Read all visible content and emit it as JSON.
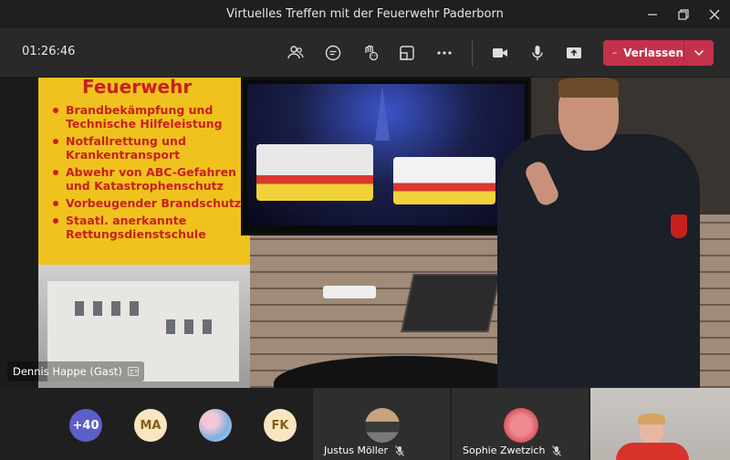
{
  "window": {
    "title": "Virtuelles Treffen mit der Feuerwehr Paderborn"
  },
  "toolbar": {
    "timer": "01:26:46",
    "leave_label": "Verlassen"
  },
  "video": {
    "poster_heading": "Feuerwehr",
    "poster_items": [
      "Brandbekämpfung und Technische Hilfeleistung",
      "Notfallrettung und Krankentransport",
      "Abwehr von ABC-Gefahren und Katastrophenschutz",
      "Vorbeugender Brandschutz",
      "Staatl. anerkannte Rettungsdienstschule"
    ],
    "speaker_name": "Dennis Happe (Gast)"
  },
  "gallery": {
    "overflow_count": "+40",
    "avatars": [
      "MA",
      "FK"
    ],
    "tiles": [
      {
        "name": "Justus Möller"
      },
      {
        "name": "Sophie Zwetzich"
      }
    ]
  },
  "colors": {
    "leave": "#c4314b",
    "overflow": "#5b5fc7",
    "initials_bg": "#f7e6c1",
    "initials_fg": "#8a5a1a"
  }
}
